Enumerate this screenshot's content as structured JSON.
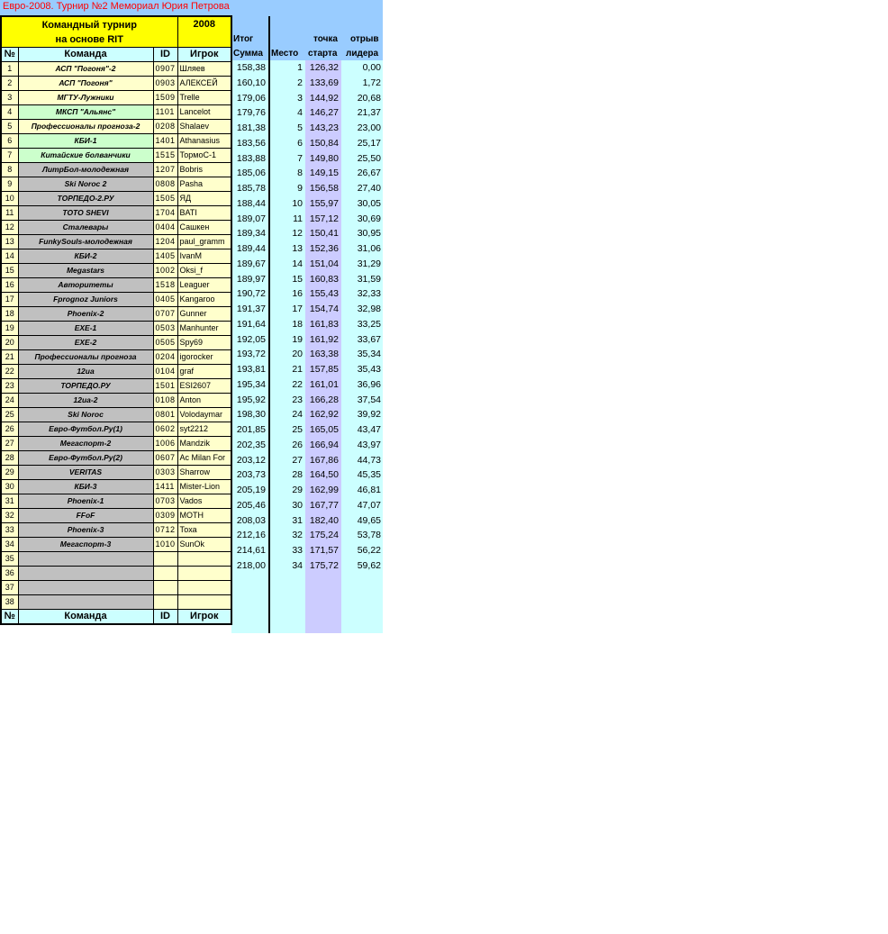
{
  "title": "Евро-2008. Турнир №2 Мемориал Юрия Петрова",
  "header": {
    "tournament_line1": "Командный турнир",
    "tournament_line2": "на основе RIT",
    "year": "2008",
    "col_num": "№",
    "col_team": "Команда",
    "col_id": "ID",
    "col_player": "Игрок",
    "col_itog_top": "Итог",
    "col_itog_bottom": "Сумма",
    "col_place": "Место",
    "col_start_top": "точка",
    "col_start_bottom": "старта",
    "col_gap_top": "отрыв",
    "col_gap_bottom": "лидера"
  },
  "footer": {
    "col_num": "№",
    "col_team": "Команда",
    "col_id": "ID",
    "col_player": "Игрок"
  },
  "rows": [
    {
      "n": "1",
      "team": "АСП \"Погоня\"-2",
      "id": "0907",
      "player": "Шляев",
      "sum": "158,38",
      "place": "1",
      "start": "126,32",
      "gap": "0,00",
      "tc": "yel"
    },
    {
      "n": "2",
      "team": "АСП \"Погоня\"",
      "id": "0903",
      "player": "АЛЕКСЕЙ",
      "sum": "160,10",
      "place": "2",
      "start": "133,69",
      "gap": "1,72",
      "tc": "yel"
    },
    {
      "n": "3",
      "team": "МГТУ-Лужники",
      "id": "1509",
      "player": "Trelle",
      "sum": "179,06",
      "place": "3",
      "start": "144,92",
      "gap": "20,68",
      "tc": "yel"
    },
    {
      "n": "4",
      "team": "МКСП \"Альянс\"",
      "id": "1101",
      "player": "Lancelot",
      "sum": "179,76",
      "place": "4",
      "start": "146,27",
      "gap": "21,37",
      "tc": "grn"
    },
    {
      "n": "5",
      "team": "Профессионалы прогноза-2",
      "id": "0208",
      "player": "Shalaev",
      "sum": "181,38",
      "place": "5",
      "start": "143,23",
      "gap": "23,00",
      "tc": "yel"
    },
    {
      "n": "6",
      "team": "КБИ-1",
      "id": "1401",
      "player": "Athanasius",
      "sum": "183,56",
      "place": "6",
      "start": "150,84",
      "gap": "25,17",
      "tc": "grn"
    },
    {
      "n": "7",
      "team": "Китайские болванчики",
      "id": "1515",
      "player": "ТормоС-1",
      "sum": "183,88",
      "place": "7",
      "start": "149,80",
      "gap": "25,50",
      "tc": "grn"
    },
    {
      "n": "8",
      "team": "ЛитрБол-молодежная",
      "id": "1207",
      "player": "Bobris",
      "sum": "185,06",
      "place": "8",
      "start": "149,15",
      "gap": "26,67",
      "tc": "gry"
    },
    {
      "n": "9",
      "team": "Ski Noroc 2",
      "id": "0808",
      "player": "Pasha",
      "sum": "185,78",
      "place": "9",
      "start": "156,58",
      "gap": "27,40",
      "tc": "gry"
    },
    {
      "n": "10",
      "team": "ТОРПЕДО-2.РУ",
      "id": "1505",
      "player": "ЯД",
      "sum": "188,44",
      "place": "10",
      "start": "155,97",
      "gap": "30,05",
      "tc": "gry"
    },
    {
      "n": "11",
      "team": "TOTO SHEVI",
      "id": "1704",
      "player": "BATI",
      "sum": "189,07",
      "place": "11",
      "start": "157,12",
      "gap": "30,69",
      "tc": "gry"
    },
    {
      "n": "12",
      "team": "Сталевары",
      "id": "0404",
      "player": "Сашкен",
      "sum": "189,34",
      "place": "12",
      "start": "150,41",
      "gap": "30,95",
      "tc": "gry"
    },
    {
      "n": "13",
      "team": "FunkySouls-молодежная",
      "id": "1204",
      "player": "paul_gramm",
      "sum": "189,44",
      "place": "13",
      "start": "152,36",
      "gap": "31,06",
      "tc": "gry"
    },
    {
      "n": "14",
      "team": "КБИ-2",
      "id": "1405",
      "player": "IvanM",
      "sum": "189,67",
      "place": "14",
      "start": "151,04",
      "gap": "31,29",
      "tc": "gry"
    },
    {
      "n": "15",
      "team": "Megastars",
      "id": "1002",
      "player": "Oksi_f",
      "sum": "189,97",
      "place": "15",
      "start": "160,83",
      "gap": "31,59",
      "tc": "gry"
    },
    {
      "n": "16",
      "team": "Авторитеты",
      "id": "1518",
      "player": "Leaguer",
      "sum": "190,72",
      "place": "16",
      "start": "155,43",
      "gap": "32,33",
      "tc": "gry"
    },
    {
      "n": "17",
      "team": "Fprognoz Juniors",
      "id": "0405",
      "player": "Kangaroo",
      "sum": "191,37",
      "place": "17",
      "start": "154,74",
      "gap": "32,98",
      "tc": "gry"
    },
    {
      "n": "18",
      "team": "Phoenix-2",
      "id": "0707",
      "player": "Gunner",
      "sum": "191,64",
      "place": "18",
      "start": "161,83",
      "gap": "33,25",
      "tc": "gry"
    },
    {
      "n": "19",
      "team": "EXE-1",
      "id": "0503",
      "player": "Manhunter",
      "sum": "192,05",
      "place": "19",
      "start": "161,92",
      "gap": "33,67",
      "tc": "gry"
    },
    {
      "n": "20",
      "team": "EXE-2",
      "id": "0505",
      "player": "Spy69",
      "sum": "193,72",
      "place": "20",
      "start": "163,38",
      "gap": "35,34",
      "tc": "gry"
    },
    {
      "n": "21",
      "team": "Профессионалы прогноза",
      "id": "0204",
      "player": "igorocker",
      "sum": "193,81",
      "place": "21",
      "start": "157,85",
      "gap": "35,43",
      "tc": "gry"
    },
    {
      "n": "22",
      "team": "12ua",
      "id": "0104",
      "player": "graf",
      "sum": "195,34",
      "place": "22",
      "start": "161,01",
      "gap": "36,96",
      "tc": "gry"
    },
    {
      "n": "23",
      "team": "ТОРПЕДО.РУ",
      "id": "1501",
      "player": "ESI2607",
      "sum": "195,92",
      "place": "23",
      "start": "166,28",
      "gap": "37,54",
      "tc": "gry"
    },
    {
      "n": "24",
      "team": "12ua-2",
      "id": "0108",
      "player": "Anton",
      "sum": "198,30",
      "place": "24",
      "start": "162,92",
      "gap": "39,92",
      "tc": "gry"
    },
    {
      "n": "25",
      "team": "Ski Noroc",
      "id": "0801",
      "player": "Volodaymar",
      "sum": "201,85",
      "place": "25",
      "start": "165,05",
      "gap": "43,47",
      "tc": "gry"
    },
    {
      "n": "26",
      "team": "Евро-Футбол.Ру(1)",
      "id": "0602",
      "player": "syt2212",
      "sum": "202,35",
      "place": "26",
      "start": "166,94",
      "gap": "43,97",
      "tc": "gry"
    },
    {
      "n": "27",
      "team": "Мегаспорт-2",
      "id": "1006",
      "player": "Mandzik",
      "sum": "203,12",
      "place": "27",
      "start": "167,86",
      "gap": "44,73",
      "tc": "gry"
    },
    {
      "n": "28",
      "team": "Евро-Футбол.Ру(2)",
      "id": "0607",
      "player": "Ac Milan For",
      "sum": "203,73",
      "place": "28",
      "start": "164,50",
      "gap": "45,35",
      "tc": "gry"
    },
    {
      "n": "29",
      "team": "VERITAS",
      "id": "0303",
      "player": "Sharrow",
      "sum": "205,19",
      "place": "29",
      "start": "162,99",
      "gap": "46,81",
      "tc": "gry"
    },
    {
      "n": "30",
      "team": "КБИ-3",
      "id": "1411",
      "player": "Mister-Lion",
      "sum": "205,46",
      "place": "30",
      "start": "167,77",
      "gap": "47,07",
      "tc": "gry"
    },
    {
      "n": "31",
      "team": "Phoenix-1",
      "id": "0703",
      "player": "Vados",
      "sum": "208,03",
      "place": "31",
      "start": "182,40",
      "gap": "49,65",
      "tc": "gry"
    },
    {
      "n": "32",
      "team": "FFoF",
      "id": "0309",
      "player": "MOTH",
      "sum": "212,16",
      "place": "32",
      "start": "175,24",
      "gap": "53,78",
      "tc": "gry"
    },
    {
      "n": "33",
      "team": "Phoenix-3",
      "id": "0712",
      "player": "Тоха",
      "sum": "214,61",
      "place": "33",
      "start": "171,57",
      "gap": "56,22",
      "tc": "gry"
    },
    {
      "n": "34",
      "team": "Мегаспорт-3",
      "id": "1010",
      "player": "SunOk",
      "sum": "218,00",
      "place": "34",
      "start": "175,72",
      "gap": "59,62",
      "tc": "gry"
    },
    {
      "n": "35",
      "team": "",
      "id": "",
      "player": "",
      "sum": "",
      "place": "",
      "start": "",
      "gap": "",
      "tc": "gry"
    },
    {
      "n": "36",
      "team": "",
      "id": "",
      "player": "",
      "sum": "",
      "place": "",
      "start": "",
      "gap": "",
      "tc": "gry"
    },
    {
      "n": "37",
      "team": "",
      "id": "",
      "player": "",
      "sum": "",
      "place": "",
      "start": "",
      "gap": "",
      "tc": "gry"
    },
    {
      "n": "38",
      "team": "",
      "id": "",
      "player": "",
      "sum": "",
      "place": "",
      "start": "",
      "gap": "",
      "tc": "gry"
    }
  ],
  "colors": {
    "title": "#ff0000",
    "header_bg": "#99ccff",
    "tournament_bg": "#ffff00",
    "num_header_bg": "#33cc33",
    "row_light": "#ffffcc",
    "row_green": "#ccffcc",
    "row_gray": "#c0c0c0",
    "column_cyan": "#ccffff",
    "column_violet": "#ccccff"
  }
}
